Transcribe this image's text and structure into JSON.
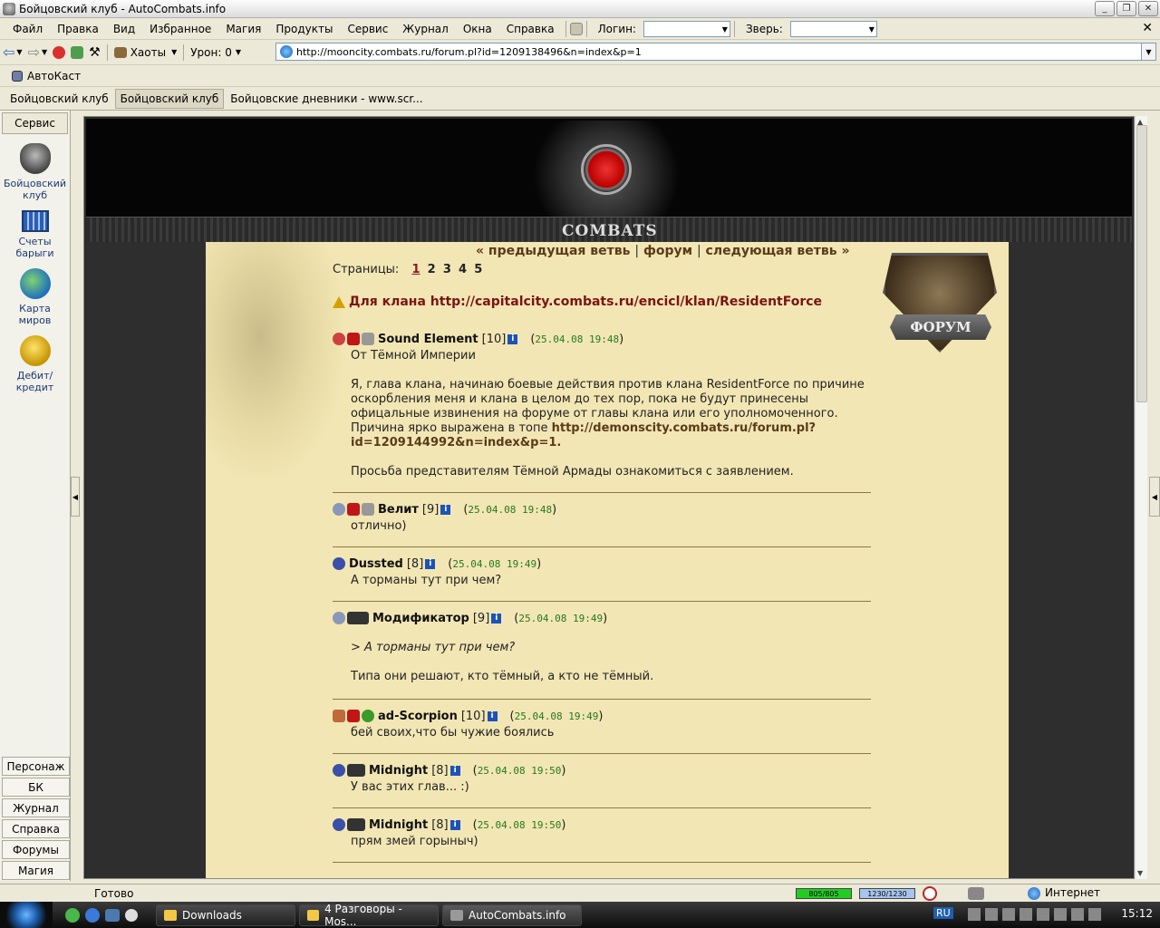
{
  "window": {
    "title": "Бойцовский клуб - AutoCombats.info"
  },
  "menu": {
    "items": [
      "Файл",
      "Правка",
      "Вид",
      "Избранное",
      "Магия",
      "Продукты",
      "Сервис",
      "Журнал",
      "Окна",
      "Справка"
    ],
    "login_label": "Логин:",
    "beast_label": "Зверь:"
  },
  "nav": {
    "chaots_label": "Хаоты",
    "damage_label": "Урон: 0",
    "url": "http://mooncity.combats.ru/forum.pl?id=1209138496&n=index&p=1"
  },
  "autocast": {
    "label": "АвтоКаст"
  },
  "tabs": [
    "Бойцовский клуб",
    "Бойцовский клуб",
    "Бойцовские дневники - www.scr..."
  ],
  "sidebar": {
    "header": "Сервис",
    "items": [
      "Бойцовский клуб",
      "Счеты барыги",
      "Карта миров",
      "Дебит/кредит"
    ],
    "buttons": [
      "Персонаж",
      "БК",
      "Журнал",
      "Справка",
      "Форумы",
      "Магия"
    ]
  },
  "forum": {
    "banner_word": "COMBATS",
    "badge_label": "ФОРУМ",
    "nav": {
      "prev": "« предыдущая ветвь",
      "sep": "|",
      "forum": "форум",
      "next": "следующая ветвь »"
    },
    "pages_label": "Страницы:",
    "pages": [
      "1",
      "2",
      "3",
      "4",
      "5"
    ],
    "thread_title": "Для клана http://capitalcity.combats.ru/encicl/klan/ResidentForce",
    "posts": [
      {
        "nick": "Sound Element",
        "level": "[10]",
        "date": "25.04.08 19:48",
        "paras": [
          "От Тёмной Империи",
          "Я, глава клана, начинаю боевые действия против клана ResidentForce по причине оскорбления меня и клана в целом до тех пор, пока не будут принесены офицальные извинения на форуме от главы клана или его уполномоченного. Причина ярко выражена в топе",
          "http://demonscity.combats.ru/forum.pl?id=1209144992&n=index&p=1.",
          "Просьба представителям Тёмной Армады ознакомиться с заявлением."
        ]
      },
      {
        "nick": "Велит",
        "level": "[9]",
        "date": "25.04.08 19:48",
        "text": "отлично)"
      },
      {
        "nick": "Dussted",
        "level": "[8]",
        "date": "25.04.08 19:49",
        "text": "А торманы тут при чем?"
      },
      {
        "nick": "Модификатор",
        "level": "[9]",
        "date": "25.04.08 19:49",
        "quote": "> А торманы тут при чем?",
        "text": "Типа они решают, кто тёмный, а кто не тёмный."
      },
      {
        "nick": "ad-Scorpion",
        "level": "[10]",
        "date": "25.04.08 19:49",
        "text": "бей своих,что бы чужие боялись"
      },
      {
        "nick": "Midnight",
        "level": "[8]",
        "date": "25.04.08 19:50",
        "text": "У вас этих глав... :)"
      },
      {
        "nick": "Midnight",
        "level": "[8]",
        "date": "25.04.08 19:50",
        "text": "прям змей горыныч)"
      }
    ]
  },
  "status": {
    "ready": "Готово",
    "hp": "805/805",
    "mana": "1230/1230",
    "zone": "Интернет"
  },
  "taskbar": {
    "tasks": [
      "Downloads",
      "4 Разговоры - Mos...",
      "AutoCombats.info"
    ],
    "lang": "RU",
    "clock": "15:12"
  }
}
